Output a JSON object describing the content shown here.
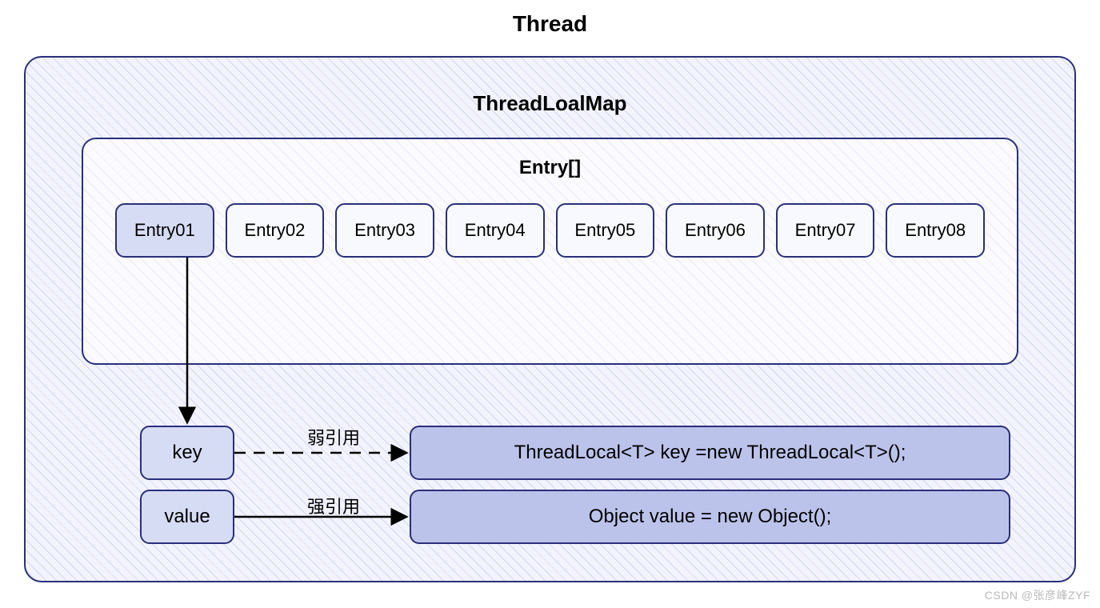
{
  "titles": {
    "thread": "Thread",
    "map": "ThreadLoalMap",
    "entryArray": "Entry[]"
  },
  "entries": [
    "Entry01",
    "Entry02",
    "Entry03",
    "Entry04",
    "Entry05",
    "Entry06",
    "Entry07",
    "Entry08"
  ],
  "kv": {
    "key": "key",
    "value": "value"
  },
  "refs": {
    "weak": "弱引用",
    "strong": "强引用"
  },
  "code": {
    "threadLocal": "ThreadLocal<T> key =new ThreadLocal<T>();",
    "object": "Object value = new Object();"
  },
  "watermark": "CSDN @张彦峰ZYF",
  "colors": {
    "border": "#2a2f7a",
    "light": "#f8f9fe",
    "mid": "#d7dcf5",
    "dark": "#bcc3ea"
  }
}
